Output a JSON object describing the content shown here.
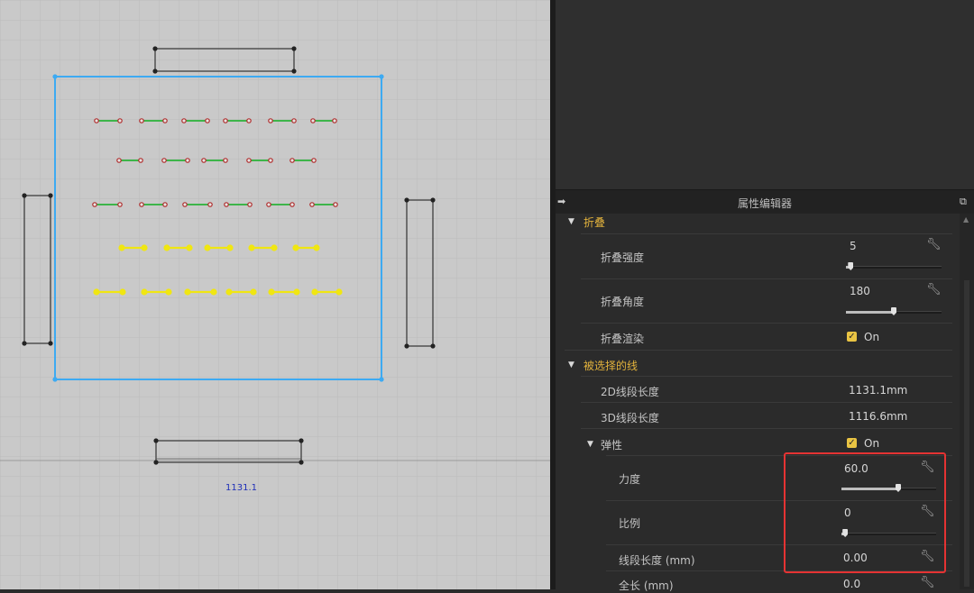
{
  "canvas": {
    "dimension_label": "1131.1"
  },
  "panel": {
    "title": "属性编辑器",
    "sections": {
      "fold": {
        "label": "折叠",
        "strength": {
          "label": "折叠强度",
          "value": "5",
          "slider_fraction": 0.05
        },
        "angle": {
          "label": "折叠角度",
          "value": "180",
          "slider_fraction": 0.5
        },
        "render": {
          "label": "折叠渲染",
          "checked": true,
          "value": "On"
        }
      },
      "selected_line": {
        "label": "被选择的线",
        "length_2d": {
          "label": "2D线段长度",
          "value": "1131.1mm"
        },
        "length_3d": {
          "label": "3D线段长度",
          "value": "1116.6mm"
        },
        "elastic": {
          "label": "弹性",
          "checked": true,
          "value": "On",
          "force": {
            "label": "力度",
            "value": "60.0",
            "slider_fraction": 0.6
          },
          "ratio": {
            "label": "比例",
            "value": "0",
            "slider_fraction": 0.0
          },
          "segment_length": {
            "label": "线段长度 (mm)",
            "value": "0.00"
          },
          "full_length": {
            "label": "全长 (mm)",
            "value": "0.0"
          }
        }
      }
    }
  },
  "icons": {
    "wrench": "wrench-icon",
    "expand": "triangle-down-icon",
    "checkbox": "checkmark-icon",
    "pin": "pin-icon",
    "popout": "popout-icon"
  },
  "colors": {
    "canvas_bg": "#c9c9c9",
    "selection_blue": "#3daaf2",
    "section_gold": "#e2b23c",
    "highlight_red": "#e53333",
    "stitch_green": "#3db54a",
    "stitch_yellow": "#f0e612",
    "stitch_red_point": "#b02a2a"
  }
}
